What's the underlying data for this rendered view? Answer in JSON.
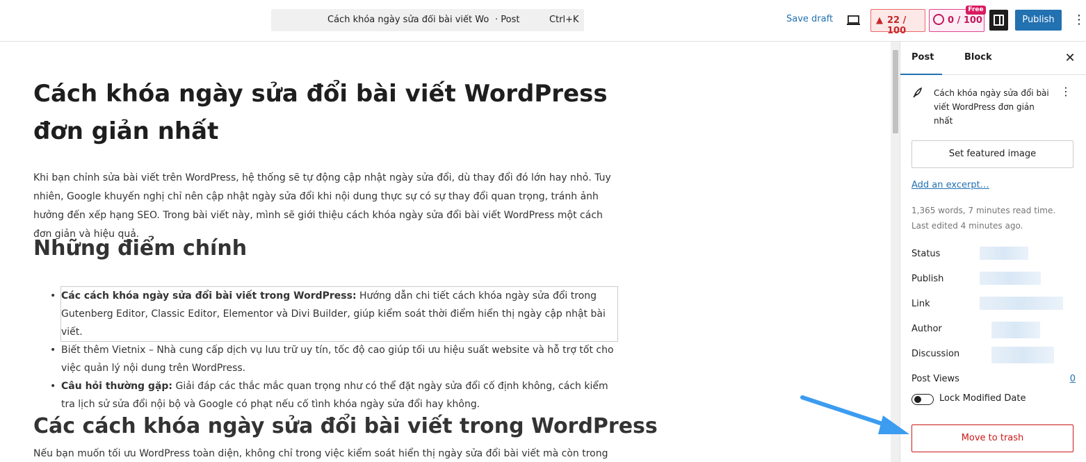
{
  "topbar": {
    "command_title": "Cách khóa ngày sửa đổi bài viết Word…",
    "command_type": "· Post",
    "command_shortcut": "Ctrl+K",
    "save_draft": "Save draft",
    "seo_score": "22 / 100",
    "ai_score": "0 / 100",
    "free_tag": "Free",
    "publish": "Publish",
    "icons": [
      "device-preview-icon",
      "seo-icon",
      "ai-icon",
      "settings-icon",
      "more-vertical-icon"
    ]
  },
  "content": {
    "title": "Cách khóa ngày sửa đổi bài viết WordPress đơn giản nhất",
    "intro": "Khi bạn chỉnh sửa bài viết trên WordPress, hệ thống sẽ tự động cập nhật ngày sửa đổi, dù thay đổi đó lớn hay nhỏ. Tuy nhiên, Google khuyến nghị chỉ nên cập nhật ngày sửa đổi khi nội dung thực sự có sự thay đổi quan trọng, tránh ảnh hưởng đến xếp hạng SEO. Trong bài viết này, mình sẽ giới thiệu cách khóa ngày sửa đổi bài viết WordPress một cách đơn giản và hiệu quả.",
    "heading_key_points": "Những điểm chính",
    "bullets": [
      {
        "bold": "Các cách khóa ngày sửa đổi bài viết trong WordPress:",
        "text": " Hướng dẫn chi tiết cách khóa ngày sửa đổi trong Gutenberg Editor, Classic Editor, Elementor và Divi Builder, giúp kiểm soát thời điểm hiển thị ngày cập nhật bài viết."
      },
      {
        "bold": "",
        "text": "Biết thêm Vietnix – Nhà cung cấp dịch vụ lưu trữ uy tín, tốc độ cao giúp tối ưu hiệu suất website và hỗ trợ tốt cho việc quản lý nội dung trên WordPress."
      },
      {
        "bold": "Câu hỏi thường gặp:",
        "text": " Giải đáp các thắc mắc quan trọng như có thể đặt ngày sửa đổi cố định không, cách kiểm tra lịch sử sửa đổi nội bộ và Google có phạt nếu cố tình khóa ngày sửa đổi hay không."
      }
    ],
    "heading_methods": "Các cách khóa ngày sửa đổi bài viết trong WordPress",
    "methods_para": "Nếu bạn muốn tối ưu WordPress toàn diện, không chỉ trong việc kiểm soát hiển thị ngày sửa đổi bài viết mà còn trong triển"
  },
  "sidebar": {
    "tab_post": "Post",
    "tab_block": "Block",
    "post_title": "Cách khóa ngày sửa đổi bài viết WordPress đơn giản nhất",
    "featured_image": "Set featured image",
    "add_excerpt": "Add an excerpt…",
    "stats_words": "1,365 words, 7 minutes read time.",
    "stats_edited": "Last edited 4 minutes ago.",
    "meta": [
      {
        "label": "Status"
      },
      {
        "label": "Publish"
      },
      {
        "label": "Link"
      },
      {
        "label": "Author"
      },
      {
        "label": "Discussion"
      }
    ],
    "post_views_label": "Post Views",
    "post_views_count": "0",
    "lock_label": "Lock Modified Date",
    "lock_enabled": false,
    "trash": "Move to trash"
  },
  "colors": {
    "accent": "#2271b1",
    "danger": "#cc1818",
    "seo": "#c62828",
    "ai": "#c2185b",
    "arrow": "#3b9cf0"
  }
}
